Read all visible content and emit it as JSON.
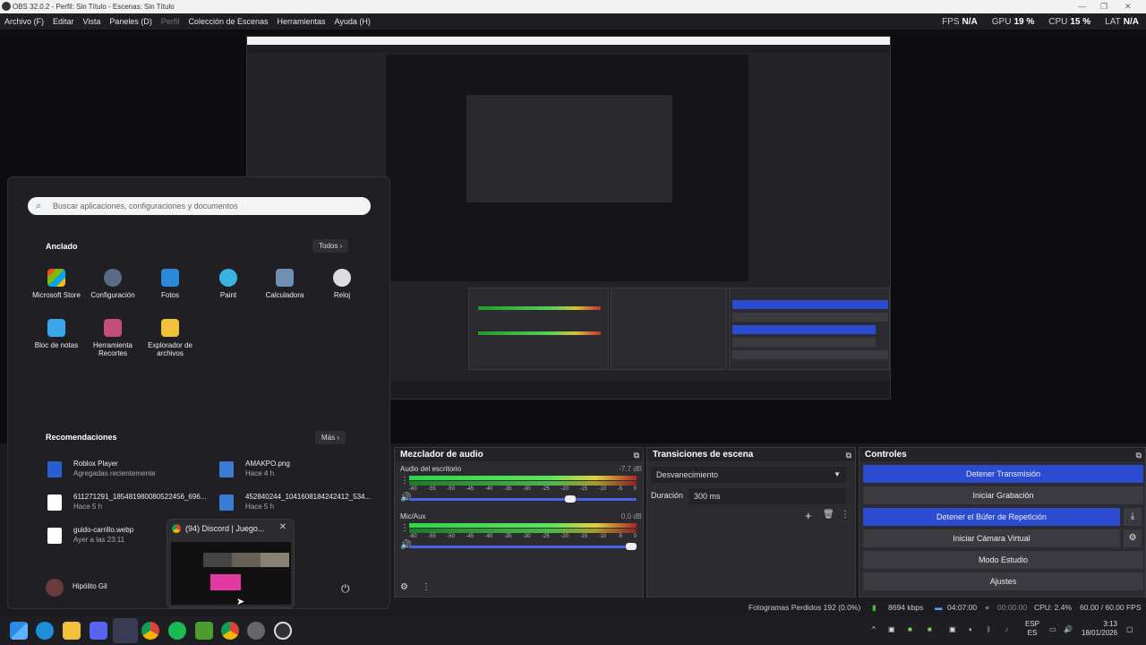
{
  "titlebar": {
    "title": "OBS 32.0.2 - Perfil: Sin Título - Escenas: Sin Título"
  },
  "menu": [
    "Archivo (F)",
    "Editar",
    "Vista",
    "Paneles (D)",
    "Perfil",
    "Colección de Escenas",
    "Herramientas",
    "Ayuda (H)"
  ],
  "stats": {
    "fps_label": "FPS",
    "fps": "N/A",
    "gpu_label": "GPU",
    "gpu": "19 %",
    "cpu_label": "CPU",
    "cpu": "15 %",
    "lat_label": "LAT",
    "lat": "N/A"
  },
  "mixer": {
    "title": "Mezclador de audio",
    "channels": [
      {
        "name": "Audio del escritorio",
        "db": "-7.7 dB",
        "volume": 0.72
      },
      {
        "name": "Mic/Aux",
        "db": "0.0 dB",
        "volume": 1.0
      }
    ],
    "scale": [
      "-60",
      "-55",
      "-50",
      "-45",
      "-40",
      "-35",
      "-30",
      "-25",
      "-20",
      "-15",
      "-10",
      "-5",
      "0"
    ]
  },
  "transitions": {
    "title": "Transiciones de escena",
    "selected": "Desvanecimiento",
    "duration_label": "Duración",
    "duration": "300 ms"
  },
  "controls": {
    "title": "Controles",
    "buttons": [
      "Detener Transmisión",
      "Iniciar Grabación",
      "Detener el Búfer de Repetición",
      "Iniciar Cámara Virtual",
      "Modo Estudio",
      "Ajustes"
    ]
  },
  "statusbar": {
    "dropped": "Fotogramas Perdidos 192 (0.0%)",
    "kbps": "8694 kbps",
    "stream_time": "04:07:00",
    "rec_time": "00:00:00",
    "cpu": "CPU: 2.4%",
    "fps": "60.00 / 60.00 FPS"
  },
  "startmenu": {
    "search_placeholder": "Buscar aplicaciones, configuraciones y documentos",
    "pinned_title": "Anclado",
    "all_label": "Todos",
    "pinned": [
      "Microsoft Store",
      "Configuración",
      "Fotos",
      "Paint",
      "Calculadora",
      "Reloj",
      "Bloc de notas",
      "Herramienta Recortes",
      "Explorador de archivos"
    ],
    "recommended_title": "Recomendaciones",
    "more_label": "Más",
    "recommended": [
      {
        "name": "Roblox Player",
        "sub": "Agregadas recientemente"
      },
      {
        "name": "AMAKPO.png",
        "sub": "Hace 4 h"
      },
      {
        "name": "611271291_185481980080522456_696...",
        "sub": "Hace 5 h"
      },
      {
        "name": "452840244_1041608184242412_534...",
        "sub": "Hace 5 h"
      },
      {
        "name": "guido-carrillo.webp",
        "sub": "Ayer a las 23:11"
      }
    ],
    "user": "Hipólito Gil"
  },
  "discord_preview": {
    "title": "(94) Discord | Juego..."
  },
  "taskbar": {
    "lang": "ESP",
    "lang2": "ES",
    "time": "3:13",
    "date": "18/01/2026"
  },
  "colors": {
    "accent": "#2b4bd1",
    "panel": "#2b2b30",
    "bg": "#1b1b1f"
  }
}
